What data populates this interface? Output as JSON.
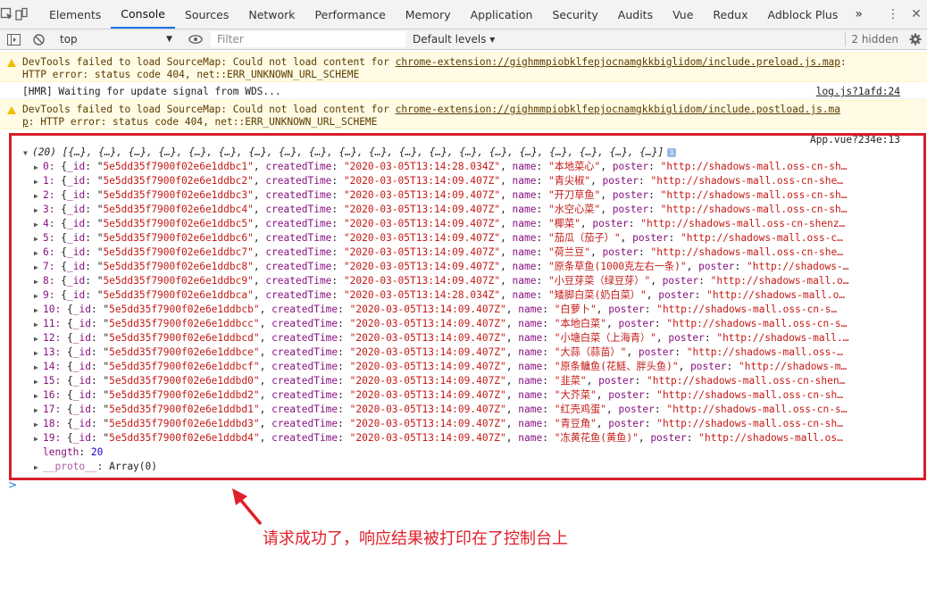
{
  "tabs": [
    "Elements",
    "Console",
    "Sources",
    "Network",
    "Performance",
    "Memory",
    "Application",
    "Security",
    "Audits",
    "Vue",
    "Redux",
    "Adblock Plus"
  ],
  "active_tab": "Console",
  "more_tabs_icon": "»",
  "toolbar": {
    "context": "top",
    "filter_placeholder": "Filter",
    "levels": "Default levels ▾",
    "hidden": "2 hidden"
  },
  "messages": {
    "warn1": {
      "line1_pre": "DevTools failed to load SourceMap: Could not load content for ",
      "line1_link": "chrome-extension://gighmmpiobklfepjocnamgkkbiglidom/include.preload.js.map",
      "line1_post": ":",
      "line2": "HTTP error: status code 404, net::ERR_UNKNOWN_URL_SCHEME"
    },
    "hmr": {
      "text": "[HMR] Waiting for update signal from WDS...",
      "source": "log.js?1afd:24"
    },
    "warn2": {
      "line1_pre": "DevTools failed to load SourceMap: Could not load content for ",
      "line1_link": "chrome-extension://gighmmpiobklfepjocnamgkkbiglidom/include.postload.js.ma",
      "line2_link": "p",
      "line2": ": HTTP error: status code 404, net::ERR_UNKNOWN_URL_SCHEME"
    },
    "array": {
      "source": "App.vue?234e:13",
      "summary": "(20) [{…}, {…}, {…}, {…}, {…}, {…}, {…}, {…}, {…}, {…}, {…}, {…}, {…}, {…}, {…}, {…}, {…}, {…}, {…}, {…}]",
      "length_label": "length",
      "length_value": "20",
      "proto_label": "__proto__",
      "proto_value": "Array(0)"
    }
  },
  "items": [
    {
      "idx": "0",
      "id": "5e5dd35f7900f02e6e1ddbc1",
      "time": "2020-03-05T13:14:28.034Z",
      "name": "本地菜心",
      "poster": "http://shadows-mall.oss-cn-sh…"
    },
    {
      "idx": "1",
      "id": "5e5dd35f7900f02e6e1ddbc2",
      "time": "2020-03-05T13:14:09.407Z",
      "name": "青尖椒",
      "poster": "http://shadows-mall.oss-cn-she…"
    },
    {
      "idx": "2",
      "id": "5e5dd35f7900f02e6e1ddbc3",
      "time": "2020-03-05T13:14:09.407Z",
      "name": "开刀草鱼",
      "poster": "http://shadows-mall.oss-cn-sh…"
    },
    {
      "idx": "3",
      "id": "5e5dd35f7900f02e6e1ddbc4",
      "time": "2020-03-05T13:14:09.407Z",
      "name": "水空心菜",
      "poster": "http://shadows-mall.oss-cn-sh…"
    },
    {
      "idx": "4",
      "id": "5e5dd35f7900f02e6e1ddbc5",
      "time": "2020-03-05T13:14:09.407Z",
      "name": "椰菜",
      "poster": "http://shadows-mall.oss-cn-shenz…"
    },
    {
      "idx": "5",
      "id": "5e5dd35f7900f02e6e1ddbc6",
      "time": "2020-03-05T13:14:09.407Z",
      "name": "茄瓜（茄子）",
      "poster": "http://shadows-mall.oss-c…"
    },
    {
      "idx": "6",
      "id": "5e5dd35f7900f02e6e1ddbc7",
      "time": "2020-03-05T13:14:09.407Z",
      "name": "荷兰豆",
      "poster": "http://shadows-mall.oss-cn-she…"
    },
    {
      "idx": "7",
      "id": "5e5dd35f7900f02e6e1ddbc8",
      "time": "2020-03-05T13:14:09.407Z",
      "name": "原条草鱼(1000克左右一条)",
      "poster": "http://shadows-…"
    },
    {
      "idx": "8",
      "id": "5e5dd35f7900f02e6e1ddbc9",
      "time": "2020-03-05T13:14:09.407Z",
      "name": "小豆芽菜（绿豆芽）",
      "poster": "http://shadows-mall.o…"
    },
    {
      "idx": "9",
      "id": "5e5dd35f7900f02e6e1ddbca",
      "time": "2020-03-05T13:14:28.034Z",
      "name": "矮脚白菜(奶白菜）",
      "poster": "http://shadows-mall.o…"
    },
    {
      "idx": "10",
      "id": "5e5dd35f7900f02e6e1ddbcb",
      "time": "2020-03-05T13:14:09.407Z",
      "name": "白萝卜",
      "poster": "http://shadows-mall.oss-cn-s…"
    },
    {
      "idx": "11",
      "id": "5e5dd35f7900f02e6e1ddbcc",
      "time": "2020-03-05T13:14:09.407Z",
      "name": "本地白菜",
      "poster": "http://shadows-mall.oss-cn-s…"
    },
    {
      "idx": "12",
      "id": "5e5dd35f7900f02e6e1ddbcd",
      "time": "2020-03-05T13:14:09.407Z",
      "name": "小塘白菜（上海青）",
      "poster": "http://shadows-mall.…"
    },
    {
      "idx": "13",
      "id": "5e5dd35f7900f02e6e1ddbce",
      "time": "2020-03-05T13:14:09.407Z",
      "name": "大蒜（蒜苗）",
      "poster": "http://shadows-mall.oss-…"
    },
    {
      "idx": "14",
      "id": "5e5dd35f7900f02e6e1ddbcf",
      "time": "2020-03-05T13:14:09.407Z",
      "name": "原条鳙鱼(花鲢、胖头鱼)",
      "poster": "http://shadows-m…"
    },
    {
      "idx": "15",
      "id": "5e5dd35f7900f02e6e1ddbd0",
      "time": "2020-03-05T13:14:09.407Z",
      "name": "韭菜",
      "poster": "http://shadows-mall.oss-cn-shen…"
    },
    {
      "idx": "16",
      "id": "5e5dd35f7900f02e6e1ddbd2",
      "time": "2020-03-05T13:14:09.407Z",
      "name": "大芥菜",
      "poster": "http://shadows-mall.oss-cn-sh…"
    },
    {
      "idx": "17",
      "id": "5e5dd35f7900f02e6e1ddbd1",
      "time": "2020-03-05T13:14:09.407Z",
      "name": "红壳鸡蛋",
      "poster": "http://shadows-mall.oss-cn-s…"
    },
    {
      "idx": "18",
      "id": "5e5dd35f7900f02e6e1ddbd3",
      "time": "2020-03-05T13:14:09.407Z",
      "name": "青豆角",
      "poster": "http://shadows-mall.oss-cn-sh…"
    },
    {
      "idx": "19",
      "id": "5e5dd35f7900f02e6e1ddbd4",
      "time": "2020-03-05T13:14:09.407Z",
      "name": "冻黄花鱼(黄鱼)",
      "poster": "http://shadows-mall.os…"
    }
  ],
  "prompt_symbol": ">",
  "annotation": "请求成功了，响应结果被打印在了控制台上",
  "colors": {
    "highlight": "#d81e2a",
    "accent": "#1a73e8",
    "string": "#c41a16",
    "key": "#881280"
  }
}
